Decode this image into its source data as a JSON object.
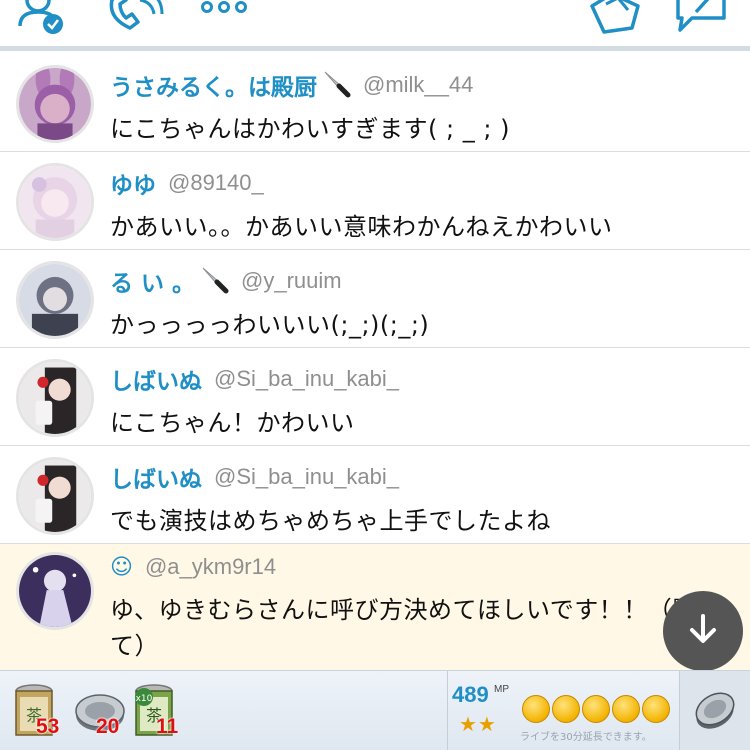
{
  "colors": {
    "accent": "#1f8fc5",
    "handle": "#8f8f8f",
    "highlight_bg": "#fff8e6",
    "count_red": "#e01010",
    "star": "#e6a100"
  },
  "toolbar": {
    "icons": [
      "user-check-icon",
      "phone-icon",
      "more-dots-icon",
      "hand-gift-icon",
      "compose-icon"
    ]
  },
  "comments": [
    {
      "name": "うさみるく。は殿厨",
      "knife": true,
      "handle": "@milk__44",
      "text": "にこちゃんはかわいすぎます( ; _ ; )",
      "highlight": false
    },
    {
      "name": "ゆゆ",
      "knife": false,
      "handle": "@89140_",
      "text": "かあいい。。かあいい意味わかんねえかわいい",
      "highlight": false
    },
    {
      "name": "る い 。",
      "knife": true,
      "handle": "@y_ruuim",
      "text": "かっっっっわいいい(;_;)(;_;)",
      "highlight": false
    },
    {
      "name": "しばいぬ",
      "knife": false,
      "handle": "@Si_ba_inu_kabi_",
      "text": "にこちゃん！かわいい",
      "highlight": false
    },
    {
      "name": "しばいぬ",
      "knife": false,
      "handle": "@Si_ba_inu_kabi_",
      "text": "でも演技はめちゃめちゃ上手でしたよね",
      "highlight": false
    },
    {
      "name": "☺",
      "knife": false,
      "handle": "@a_ykm9r14",
      "text": "ゆ、ゆきむらさんに呼び方決めてほしいです！！（黙って）",
      "highlight": true
    }
  ],
  "gifts": [
    {
      "icon": "tea-can-icon",
      "count": "53"
    },
    {
      "icon": "silver-coin-icon",
      "count": "20"
    },
    {
      "icon": "tea-can-x10-icon",
      "count": "11"
    }
  ],
  "mp": {
    "value": "489",
    "unit": "MP",
    "stars": "★★",
    "coins_count": 5,
    "extend_text": "ライブを30分延長できます。"
  }
}
